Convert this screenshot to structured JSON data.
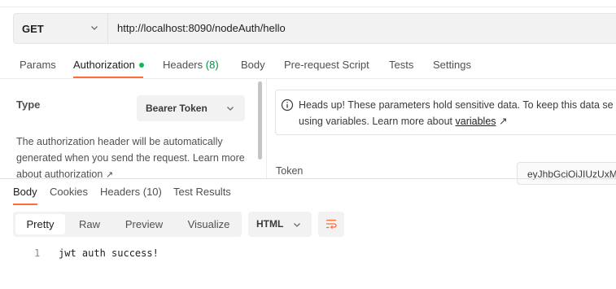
{
  "request": {
    "method": "GET",
    "url": "http://localhost:8090/nodeAuth/hello"
  },
  "request_tabs": [
    {
      "label": "Params"
    },
    {
      "label": "Authorization",
      "active": true,
      "indicator": "green-dot"
    },
    {
      "label": "Headers",
      "count": "(8)"
    },
    {
      "label": "Body"
    },
    {
      "label": "Pre-request Script"
    },
    {
      "label": "Tests"
    },
    {
      "label": "Settings"
    }
  ],
  "auth": {
    "type_label": "Type",
    "type_value": "Bearer Token",
    "description": "The authorization header will be automatically generated when you send the request. Learn more about authorization",
    "description_arrow": "↗",
    "notice_text": "Heads up! These parameters hold sensitive data. To keep this data se",
    "notice_text_2": "using variables. Learn more about",
    "notice_link": "variables",
    "notice_arrow": "↗",
    "token_label": "Token",
    "token_value": "eyJhbGciOiJIUzUxM"
  },
  "response_tabs": [
    {
      "label": "Body",
      "active": true
    },
    {
      "label": "Cookies"
    },
    {
      "label": "Headers (10)"
    },
    {
      "label": "Test Results"
    }
  ],
  "response_view": {
    "modes": [
      "Pretty",
      "Raw",
      "Preview",
      "Visualize"
    ],
    "active_mode": "Pretty",
    "format": "HTML"
  },
  "response_body": {
    "lines": [
      {
        "number": "1",
        "text": "jwt auth success!"
      }
    ]
  },
  "colors": {
    "accent": "#ff6c37",
    "active_dot": "#0cbb52",
    "count_green": "#0f8a3f"
  },
  "icons": [
    "chevron-down-icon",
    "info-icon",
    "external-link-icon",
    "wrap-lines-icon"
  ]
}
